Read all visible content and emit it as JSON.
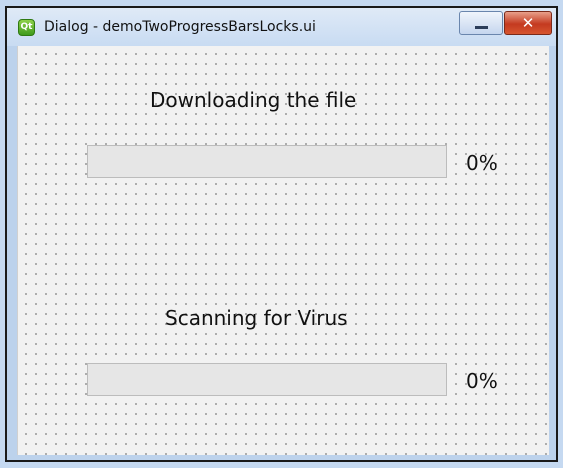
{
  "window": {
    "title": "Dialog - demoTwoProgressBarsLocks.ui",
    "app_icon": "qt-designer-icon",
    "minimize_icon": "minimize-icon",
    "close_icon": "close-icon",
    "close_glyph": "✕",
    "icon_text": "Qt"
  },
  "download": {
    "label": "Downloading the file",
    "progress_fraction": 0,
    "percent_text": "0%"
  },
  "scan": {
    "label": "Scanning for Virus",
    "progress_fraction": 0,
    "percent_text": "0%"
  },
  "colors": {
    "titlebar": "#c8dbf2",
    "close_button": "#c43a20",
    "client_background": "#f2f2f2",
    "progress_track": "#e6e6e6",
    "progress_fill": "#06b025"
  }
}
